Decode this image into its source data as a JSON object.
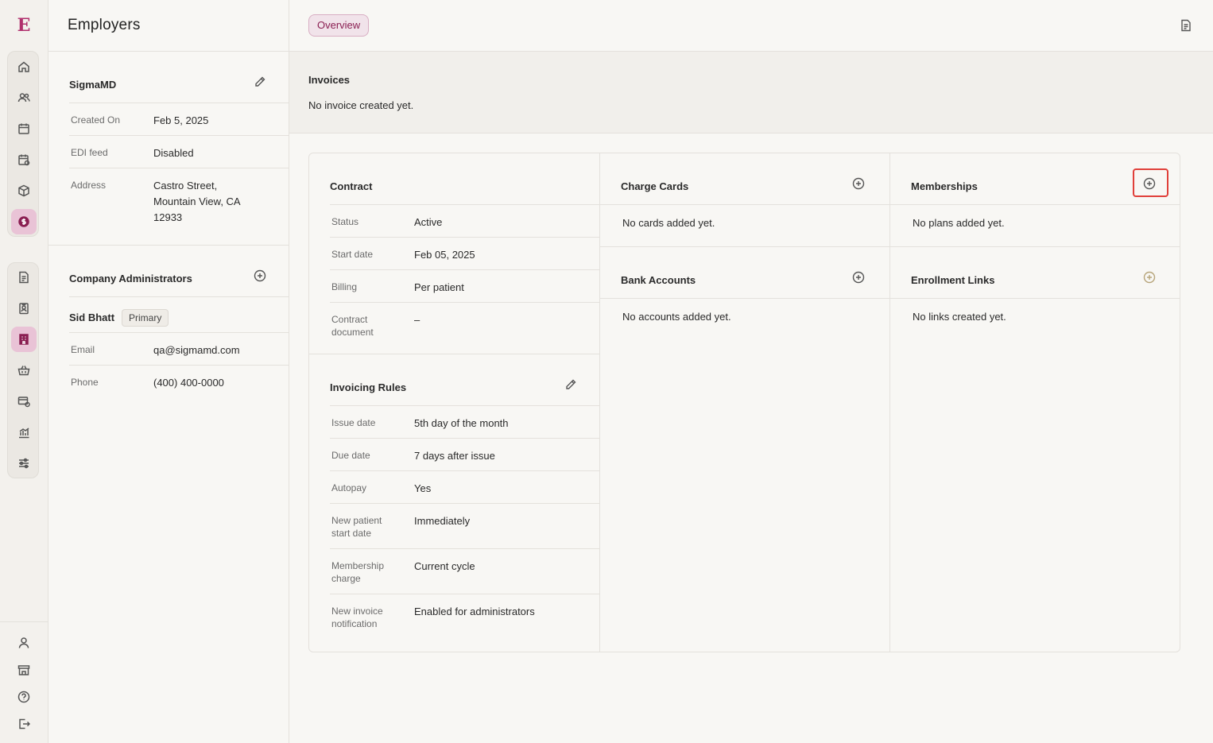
{
  "app": {
    "logo_letter": "E"
  },
  "page": {
    "title": "Employers"
  },
  "employer": {
    "name": "SigmaMD",
    "fields": [
      {
        "key": "Created On",
        "value": "Feb 5, 2025"
      },
      {
        "key": "EDI feed",
        "value": "Disabled"
      },
      {
        "key": "Address",
        "value": "Castro Street,\nMountain View, CA\n12933"
      }
    ]
  },
  "admins": {
    "title": "Company Administrators",
    "admin_name": "Sid Bhatt",
    "badge": "Primary",
    "fields": [
      {
        "key": "Email",
        "value": "qa@sigmamd.com"
      },
      {
        "key": "Phone",
        "value": "(400) 400-0000"
      }
    ]
  },
  "tabs": {
    "overview": "Overview"
  },
  "invoices": {
    "title": "Invoices",
    "empty": "No invoice created yet."
  },
  "contract": {
    "title": "Contract",
    "fields": [
      {
        "key": "Status",
        "value": "Active"
      },
      {
        "key": "Start date",
        "value": "Feb 05, 2025"
      },
      {
        "key": "Billing",
        "value": "Per patient"
      },
      {
        "key": "Contract\ndocument",
        "value": "–"
      }
    ]
  },
  "invoicing_rules": {
    "title": "Invoicing Rules",
    "fields": [
      {
        "key": "Issue date",
        "value": "5th day of the month"
      },
      {
        "key": "Due date",
        "value": "7 days after issue"
      },
      {
        "key": "Autopay",
        "value": "Yes"
      },
      {
        "key": "New patient\nstart date",
        "value": "Immediately"
      },
      {
        "key": "Membership\ncharge",
        "value": "Current cycle"
      },
      {
        "key": "New invoice\nnotification",
        "value": "Enabled for administrators"
      }
    ]
  },
  "charge_cards": {
    "title": "Charge Cards",
    "empty": "No cards added yet."
  },
  "bank_accounts": {
    "title": "Bank Accounts",
    "empty": "No accounts added yet."
  },
  "memberships": {
    "title": "Memberships",
    "empty": "No plans added yet."
  },
  "enrollment_links": {
    "title": "Enrollment Links",
    "empty": "No links created yet."
  },
  "colors": {
    "accent": "#8a1f52",
    "accent_bg": "#e9c3d6",
    "highlight": "#e0403a",
    "muted_plus": "#b7a57a"
  },
  "icons": {
    "rail_top": [
      "home-icon",
      "users-icon",
      "calendar-icon",
      "calendar-check-icon",
      "package-icon",
      "dollar-icon"
    ],
    "rail_mid": [
      "document-icon",
      "badge-icon",
      "building-icon",
      "basket-icon",
      "card-settings-icon",
      "chart-icon",
      "sliders-icon"
    ],
    "rail_bottom": [
      "user-icon",
      "store-icon",
      "help-icon",
      "logout-icon"
    ]
  }
}
